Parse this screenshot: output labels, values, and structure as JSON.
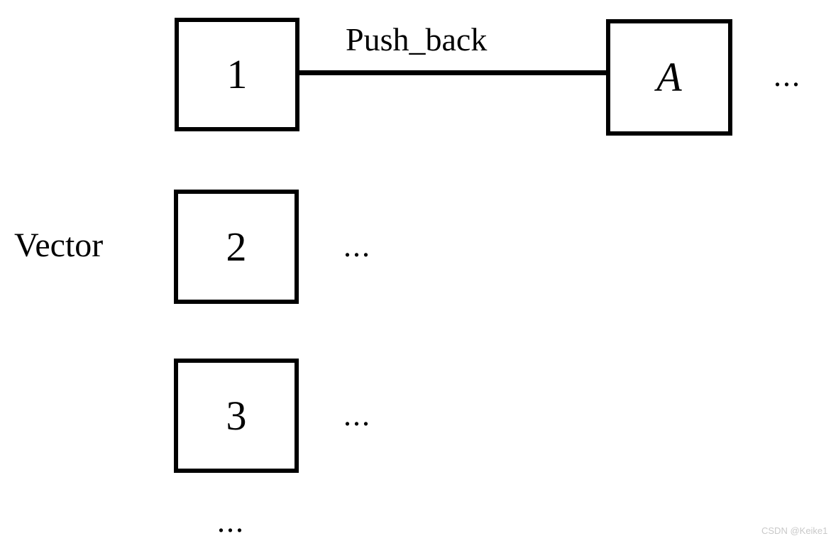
{
  "diagram": {
    "container_label": "Vector",
    "edge_label": "Push_back",
    "boxes": [
      {
        "id": "row1-index",
        "text": "1"
      },
      {
        "id": "row1-value",
        "text": "A"
      },
      {
        "id": "row2-index",
        "text": "2"
      },
      {
        "id": "row3-index",
        "text": "3"
      }
    ],
    "ellipses": [
      {
        "id": "row1-tail",
        "text": "..."
      },
      {
        "id": "row2-tail",
        "text": "..."
      },
      {
        "id": "row3-tail",
        "text": "..."
      },
      {
        "id": "column-tail",
        "text": "..."
      }
    ]
  },
  "watermark": {
    "text": "CSDN @Keike1"
  }
}
